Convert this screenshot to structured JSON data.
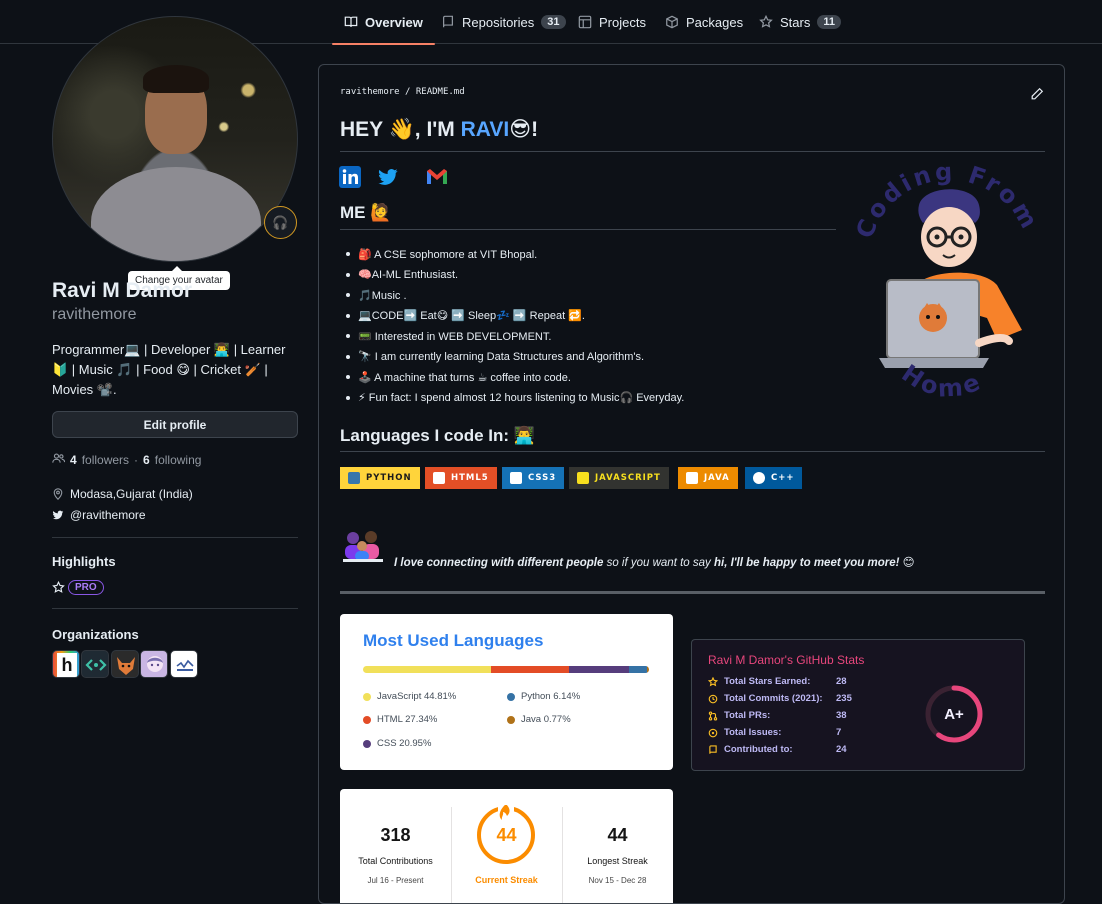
{
  "nav": {
    "tabs": [
      {
        "label": "Overview",
        "icon": "book-icon",
        "count": null,
        "selected": true
      },
      {
        "label": "Repositories",
        "icon": "repo-icon",
        "count": "31"
      },
      {
        "label": "Projects",
        "icon": "table-icon",
        "count": null
      },
      {
        "label": "Packages",
        "icon": "package-icon",
        "count": null
      },
      {
        "label": "Stars",
        "icon": "star-icon",
        "count": "11"
      }
    ]
  },
  "profile": {
    "avatar_tooltip": "Change your avatar",
    "name": "Ravi M Damor",
    "login": "ravithemore",
    "bio": "Programmer💻 | Developer 👨‍💻 | Learner 🔰 | Music 🎵 | Food 😋 | Cricket 🏏 | Movies 📽️.",
    "edit_label": "Edit profile",
    "followers_count": "4",
    "followers_label": "followers",
    "separator": "·",
    "following_count": "6",
    "following_label": "following",
    "location": "Modasa,Gujarat (India)",
    "twitter": "@ravithemore",
    "highlights_title": "Highlights",
    "pro_label": "PRO",
    "orgs_title": "Organizations"
  },
  "readme": {
    "breadcrumb": "ravithemore / README.md",
    "heading_prefix": "HEY 👋, I'M ",
    "heading_name": "RAVI",
    "heading_suffix": "😎!",
    "me_title": "ME 🙋",
    "facts": [
      "🎒 A CSE sophomore at VIT Bhopal.",
      "🧠AI-ML Enthusiast.",
      "🎵Music .",
      "💻CODE➡️ Eat😋 ➡️ Sleep💤 ➡️ Repeat 🔁.",
      "📟 Interested in WEB DEVELOPMENT.",
      "🔭 I am currently learning Data Structures and Algorithm's.",
      "🕹️ A machine that turns ☕ coffee into code.",
      "⚡ Fun fact: I spend almost 12 hours listening to Music🎧 Everyday."
    ],
    "languages_title": "Languages I code In: 👨‍💻",
    "badges": [
      {
        "label": "PYTHON",
        "color": "#ffd43b",
        "text": "#1b1b1b"
      },
      {
        "label": "HTML5",
        "color": "#e34f26",
        "text": "#ffffff"
      },
      {
        "label": "CSS3",
        "color": "#1572b6",
        "text": "#ffffff"
      },
      {
        "label": "JAVASCRIPT",
        "color": "#323330",
        "text": "#f7df1e"
      },
      {
        "label": "JAVA",
        "color": "#ed8b00",
        "text": "#ffffff"
      },
      {
        "label": "C++",
        "color": "#00599c",
        "text": "#ffffff"
      }
    ],
    "connect_bold": "I love connecting with different people",
    "connect_mid": " so if you want to say ",
    "connect_bold2": "hi, I'll be happy to meet you more!",
    "connect_emoji": " 😊",
    "illustration_text_top": "Coding From",
    "illustration_text_bottom": "Home"
  },
  "top_langs": {
    "title": "Most Used Languages",
    "items": [
      {
        "name": "JavaScript",
        "percent": 44.81,
        "label": "JavaScript 44.81%",
        "color": "#f1e05a"
      },
      {
        "name": "HTML",
        "percent": 27.34,
        "label": "HTML 27.34%",
        "color": "#e34c26"
      },
      {
        "name": "CSS",
        "percent": 20.95,
        "label": "CSS 20.95%",
        "color": "#563d7c"
      },
      {
        "name": "Python",
        "percent": 6.14,
        "label": "Python 6.14%",
        "color": "#3572a5"
      },
      {
        "name": "Java",
        "percent": 0.77,
        "label": "Java 0.77%",
        "color": "#b07219"
      }
    ]
  },
  "stats": {
    "title": "Ravi M Damor's GitHub Stats",
    "rows": [
      {
        "label": "Total Stars Earned:",
        "value": "28",
        "icon": "star-icon"
      },
      {
        "label": "Total Commits (2021):",
        "value": "235",
        "icon": "history-icon"
      },
      {
        "label": "Total PRs:",
        "value": "38",
        "icon": "pull-request-icon"
      },
      {
        "label": "Total Issues:",
        "value": "7",
        "icon": "issue-icon"
      },
      {
        "label": "Contributed to:",
        "value": "24",
        "icon": "repo-icon"
      }
    ],
    "grade": "A+",
    "grade_progress": 0.6,
    "colors": {
      "title": "#e7467c",
      "text": "#beb9f4",
      "icon": "#fbbf24",
      "ring": "#e7467c"
    }
  },
  "streak": {
    "total": "318",
    "total_label": "Total Contributions",
    "total_range": "Jul 16 - Present",
    "current": "44",
    "current_label": "Current Streak",
    "longest": "44",
    "longest_label": "Longest Streak",
    "longest_range": "Nov 15 - Dec 28"
  }
}
